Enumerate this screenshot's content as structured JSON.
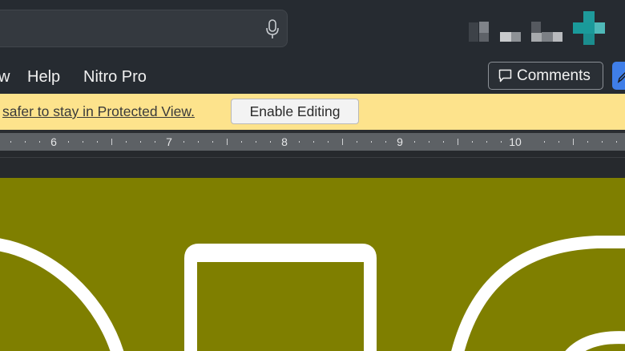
{
  "menu": {
    "partial_item": "w",
    "help": "Help",
    "nitro": "Nitro Pro"
  },
  "toolbar": {
    "comments_label": "Comments"
  },
  "protected_view": {
    "message": "safer to stay in Protected View.",
    "enable_label": "Enable Editing"
  },
  "ruler": {
    "labels": [
      "6",
      "7",
      "8",
      "9",
      "10"
    ]
  },
  "colors": {
    "titlebar": "#262b31",
    "protected_bar": "#fde38c",
    "canvas": "#7f7f00",
    "accent": "#3f7ee8",
    "avatar_teal": "#1a9a9a"
  },
  "icons": {
    "search": "microphone-icon",
    "comments": "comment-bubble-icon",
    "editing": "pen-icon"
  }
}
